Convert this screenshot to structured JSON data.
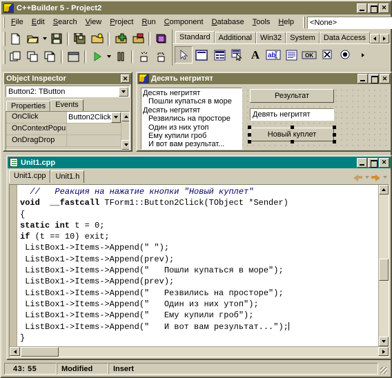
{
  "app": {
    "title": "C++Builder 5 - Project2",
    "icon": "cppbuilder-icon",
    "window_buttons": {
      "minimize": "_",
      "maximize": "□",
      "close": "✕"
    }
  },
  "menubar": {
    "items": [
      {
        "label": "File",
        "accel": "F"
      },
      {
        "label": "Edit",
        "accel": "E"
      },
      {
        "label": "Search",
        "accel": "S"
      },
      {
        "label": "View",
        "accel": "V"
      },
      {
        "label": "Project",
        "accel": "P"
      },
      {
        "label": "Run",
        "accel": "R"
      },
      {
        "label": "Component",
        "accel": "C"
      },
      {
        "label": "Database",
        "accel": "D"
      },
      {
        "label": "Tools",
        "accel": "T"
      },
      {
        "label": "Help",
        "accel": "H"
      }
    ],
    "project_combo": {
      "value": "<None>",
      "arrow_icon": "chevron-down-icon"
    }
  },
  "toolbar": {
    "row1": [
      "new-file-icon",
      "open-file-icon",
      "open-dropdown-caret",
      "save-icon",
      "save-all-icon",
      "open-project-icon",
      "add-to-project-icon",
      "remove-from-project-icon",
      "help-icon"
    ],
    "row2": [
      "toggle-form-unit-icon",
      "select-unit-icon",
      "select-form-icon",
      "new-form-icon",
      "run-icon",
      "run-dropdown-caret",
      "pause-icon",
      "trace-into-icon",
      "step-over-icon"
    ]
  },
  "palette": {
    "tabs": [
      {
        "label": "Standard",
        "active": true
      },
      {
        "label": "Additional",
        "active": false
      },
      {
        "label": "Win32",
        "active": false
      },
      {
        "label": "System",
        "active": false
      },
      {
        "label": "Data Access",
        "active": false
      }
    ],
    "scroll_left_icon": "arrow-left-icon",
    "scroll_right_icon": "arrow-right-icon",
    "components": [
      "pointer-icon",
      "frames-icon",
      "main-menu-icon",
      "popup-menu-icon",
      "label-icon",
      "edit-icon",
      "memo-icon",
      "button-icon",
      "checkbox-icon",
      "radiobutton-icon",
      "more-icon"
    ]
  },
  "object_inspector": {
    "title": "Object Inspector",
    "close_icon": "close-icon",
    "selected_object": "Button2: TButton",
    "combo_arrow_icon": "chevron-down-icon",
    "tabs": [
      {
        "label": "Properties",
        "active": false
      },
      {
        "label": "Events",
        "active": true
      }
    ],
    "rows": [
      {
        "name": "OnClick",
        "value": "Button2Click",
        "selected": true,
        "has_dropdown": true
      },
      {
        "name": "OnContextPopu",
        "value": "",
        "selected": false,
        "has_dropdown": false
      },
      {
        "name": "OnDragDrop",
        "value": "",
        "selected": false,
        "has_dropdown": false
      }
    ],
    "scroll_up_icon": "scroll-up-icon",
    "scroll_down_icon": "scroll-down-icon"
  },
  "form_designer": {
    "title": "Десять негритят",
    "icon": "form-icon",
    "window_buttons": {
      "minimize": "_",
      "maximize": "□",
      "close": "✕"
    },
    "listbox": {
      "name": "ListBox1",
      "items": [
        {
          "text": "Десять негритят",
          "indent": false
        },
        {
          "text": "Пошли купаться в море",
          "indent": true
        },
        {
          "text": "Десять негритят",
          "indent": false
        },
        {
          "text": "Резвились на просторе",
          "indent": true
        },
        {
          "text": "Один из них утоп",
          "indent": true
        },
        {
          "text": "Ему купили гроб",
          "indent": true
        },
        {
          "text": "И вот вам результат...",
          "indent": true
        }
      ]
    },
    "button_result": {
      "label": "Результат",
      "selected": false
    },
    "edit_field": {
      "value": "Девять негритят"
    },
    "button_new_verse": {
      "label": "Новый куплет",
      "selected": true
    }
  },
  "editor": {
    "title": "Unit1.cpp",
    "icon": "source-file-icon",
    "window_buttons": {
      "minimize": "_",
      "maximize": "□",
      "close": "✕"
    },
    "tabs": [
      {
        "label": "Unit1.cpp",
        "active": true
      },
      {
        "label": "Unit1.h",
        "active": false
      }
    ],
    "nav": {
      "back_icon": "arrow-back-icon",
      "back_caret_icon": "chevron-down-icon",
      "forward_icon": "arrow-forward-icon",
      "forward_caret_icon": "chevron-down-icon"
    },
    "code_lines": [
      [
        {
          "t": "  ",
          "s": "plain"
        },
        {
          "t": "//   Реакция на нажатие кнопки \"Новый куплет\"",
          "s": "comment"
        }
      ],
      [
        {
          "t": "void  __fastcall",
          "s": "keyword"
        },
        {
          "t": " TForm1::Button2Click(TObject *Sender)",
          "s": "plain"
        }
      ],
      [
        {
          "t": "{",
          "s": "plain"
        }
      ],
      [
        {
          "t": "static int",
          "s": "keyword"
        },
        {
          "t": " t = 0;",
          "s": "plain"
        }
      ],
      [
        {
          "t": "if",
          "s": "keyword"
        },
        {
          "t": " (t == 10) exit;",
          "s": "plain"
        }
      ],
      [
        {
          "t": " ListBox1->Items->Append(\" \");",
          "s": "plain"
        }
      ],
      [
        {
          "t": " ListBox1->Items->Append(prev);",
          "s": "plain"
        }
      ],
      [
        {
          "t": " ListBox1->Items->Append(\"   Пошли купаться в море\");",
          "s": "plain"
        }
      ],
      [
        {
          "t": " ListBox1->Items->Append(prev);",
          "s": "plain"
        }
      ],
      [
        {
          "t": " ListBox1->Items->Append(\"   Резвились на просторе\");",
          "s": "plain"
        }
      ],
      [
        {
          "t": " ListBox1->Items->Append(\"   Один из них утоп\");",
          "s": "plain"
        }
      ],
      [
        {
          "t": " ListBox1->Items->Append(\"   Ему купили гроб\");",
          "s": "plain"
        }
      ],
      [
        {
          "t": " ListBox1->Items->Append(\"   И вот вам результат...\");",
          "s": "plain",
          "caret": true
        }
      ],
      [
        {
          "t": "}",
          "s": "plain"
        }
      ]
    ],
    "scrollbars": {
      "v_up_icon": "scroll-up-icon",
      "v_down_icon": "scroll-down-icon",
      "h_left_icon": "scroll-left-icon",
      "h_right_icon": "scroll-right-icon"
    }
  },
  "statusbar": {
    "cursor_position": "43:  55",
    "modified": "Modified",
    "insert_mode": "Insert",
    "resize_grip_icon": "resize-grip-icon"
  },
  "colors": {
    "titlebar_active": "#7b7852",
    "titlebar_editor": "#008080",
    "face": "#d0ccb8",
    "desktop": "#ccc8b4",
    "comment": "#000060"
  }
}
